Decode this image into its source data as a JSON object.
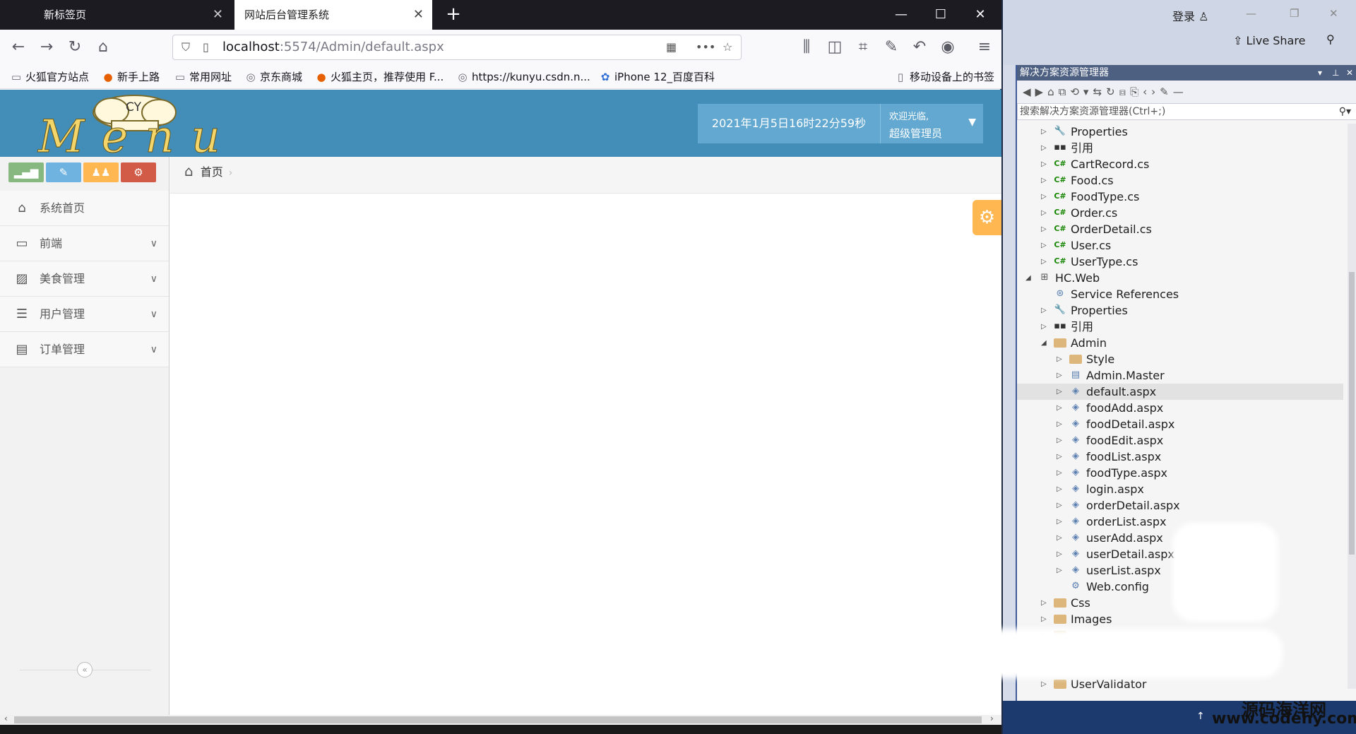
{
  "browser": {
    "tabs": [
      {
        "label": "新标签页",
        "active": false
      },
      {
        "label": "网站后台管理系统",
        "active": true
      }
    ],
    "url": {
      "host": "localhost",
      "path": ":5574/Admin/default.aspx"
    },
    "bookmarks": [
      "火狐官方站点",
      "新手上路",
      "常用网址",
      "京东商城",
      "火狐主页，推荐使用 F...",
      "https://kunyu.csdn.n...",
      "iPhone 12_百度百科"
    ],
    "mobile_bookmarks": "移动设备上的书签"
  },
  "admin": {
    "logo_text": "CY",
    "logo_script": "Menu",
    "datetime": "2021年1月5日16时22分59秒",
    "welcome": "欢迎光临,",
    "username": "超级管理员",
    "shortcut_colors": [
      "#87b87f",
      "#6fb3e0",
      "#ffb752",
      "#d15b47"
    ],
    "menu": [
      {
        "label": "系统首页",
        "icon": "home-icon",
        "expandable": false
      },
      {
        "label": "前端",
        "icon": "desktop-icon",
        "expandable": true
      },
      {
        "label": "美食管理",
        "icon": "picture-icon",
        "expandable": true
      },
      {
        "label": "用户管理",
        "icon": "list-icon",
        "expandable": true
      },
      {
        "label": "订单管理",
        "icon": "credit-card-icon",
        "expandable": true
      }
    ],
    "breadcrumb": "首页"
  },
  "vs": {
    "login": "登录",
    "liveshare": "Live Share",
    "panel_title": "解决方案资源管理器",
    "search_placeholder": "搜索解决方案资源管理器(Ctrl+;)",
    "tree": [
      {
        "label": "Properties",
        "level": 1,
        "icon": "wrench",
        "expander": "closed"
      },
      {
        "label": "引用",
        "level": 1,
        "icon": "ref",
        "expander": "closed"
      },
      {
        "label": "CartRecord.cs",
        "level": 1,
        "icon": "cs",
        "expander": "closed"
      },
      {
        "label": "Food.cs",
        "level": 1,
        "icon": "cs",
        "expander": "closed"
      },
      {
        "label": "FoodType.cs",
        "level": 1,
        "icon": "cs",
        "expander": "closed"
      },
      {
        "label": "Order.cs",
        "level": 1,
        "icon": "cs",
        "expander": "closed"
      },
      {
        "label": "OrderDetail.cs",
        "level": 1,
        "icon": "cs",
        "expander": "closed"
      },
      {
        "label": "User.cs",
        "level": 1,
        "icon": "cs",
        "expander": "closed"
      },
      {
        "label": "UserType.cs",
        "level": 1,
        "icon": "cs",
        "expander": "closed"
      },
      {
        "label": "HC.Web",
        "level": 0,
        "icon": "proj",
        "expander": "open"
      },
      {
        "label": "Service References",
        "level": 1,
        "icon": "svc",
        "expander": "none"
      },
      {
        "label": "Properties",
        "level": 1,
        "icon": "wrench",
        "expander": "closed"
      },
      {
        "label": "引用",
        "level": 1,
        "icon": "ref",
        "expander": "closed"
      },
      {
        "label": "Admin",
        "level": 1,
        "icon": "folder",
        "expander": "open"
      },
      {
        "label": "Style",
        "level": 2,
        "icon": "folder",
        "expander": "closed"
      },
      {
        "label": "Admin.Master",
        "level": 2,
        "icon": "master",
        "expander": "closed"
      },
      {
        "label": "default.aspx",
        "level": 2,
        "icon": "aspx",
        "expander": "closed",
        "selected": true
      },
      {
        "label": "foodAdd.aspx",
        "level": 2,
        "icon": "aspx",
        "expander": "closed"
      },
      {
        "label": "foodDetail.aspx",
        "level": 2,
        "icon": "aspx",
        "expander": "closed"
      },
      {
        "label": "foodEdit.aspx",
        "level": 2,
        "icon": "aspx",
        "expander": "closed"
      },
      {
        "label": "foodList.aspx",
        "level": 2,
        "icon": "aspx",
        "expander": "closed"
      },
      {
        "label": "foodType.aspx",
        "level": 2,
        "icon": "aspx",
        "expander": "closed"
      },
      {
        "label": "login.aspx",
        "level": 2,
        "icon": "aspx",
        "expander": "closed"
      },
      {
        "label": "orderDetail.aspx",
        "level": 2,
        "icon": "aspx",
        "expander": "closed"
      },
      {
        "label": "orderList.aspx",
        "level": 2,
        "icon": "aspx",
        "expander": "closed"
      },
      {
        "label": "userAdd.aspx",
        "level": 2,
        "icon": "aspx",
        "expander": "closed"
      },
      {
        "label": "userDetail.aspx",
        "level": 2,
        "icon": "aspx",
        "expander": "closed"
      },
      {
        "label": "userList.aspx",
        "level": 2,
        "icon": "aspx",
        "expander": "closed"
      },
      {
        "label": "Web.config",
        "level": 2,
        "icon": "config",
        "expander": "none"
      },
      {
        "label": "Css",
        "level": 1,
        "icon": "folder",
        "expander": "closed"
      },
      {
        "label": "Images",
        "level": 1,
        "icon": "folder",
        "expander": "closed"
      },
      {
        "label": "",
        "level": 1,
        "icon": "folder",
        "expander": "closed"
      },
      {
        "label": "",
        "level": 1,
        "icon": "folder",
        "expander": "closed"
      },
      {
        "label": "",
        "level": 1,
        "icon": "folder",
        "expander": "closed"
      },
      {
        "label": "UserValidator",
        "level": 1,
        "icon": "folder",
        "expander": "closed"
      }
    ]
  },
  "watermark": {
    "cn": "源码海洋网",
    "url": "www.codehy.com"
  }
}
